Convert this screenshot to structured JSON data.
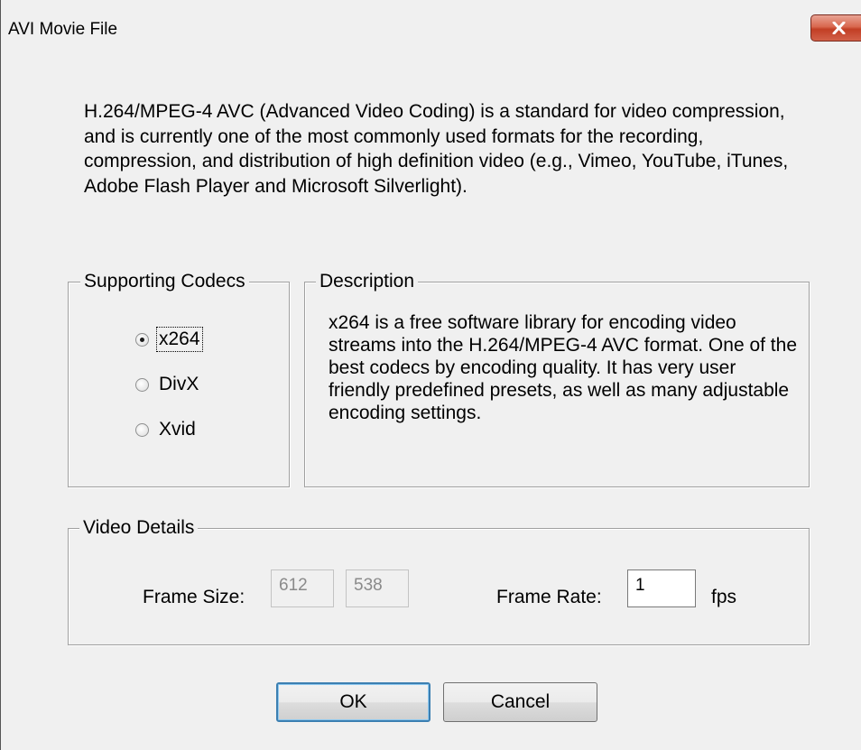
{
  "window": {
    "title": "AVI Movie File",
    "close_icon": "close-x-icon",
    "close_color": "#c74a32"
  },
  "intro": {
    "text": "H.264/MPEG-4 AVC (Advanced Video Coding) is a standard for video compression, and is currently one of the most commonly used formats for the recording, compression, and distribution of high definition video (e.g., Vimeo, YouTube, iTunes, Adobe Flash Player and Microsoft Silverlight)."
  },
  "codecs": {
    "legend": "Supporting Codecs",
    "options": [
      {
        "label": "x264",
        "selected": true
      },
      {
        "label": "DivX",
        "selected": false
      },
      {
        "label": "Xvid",
        "selected": false
      }
    ]
  },
  "description": {
    "legend": "Description",
    "text": "x264 is a free software library for encoding video streams into the H.264/MPEG-4 AVC format. One of the best codecs by encoding quality. It has very user friendly predefined presets, as well as many adjustable encoding settings."
  },
  "video_details": {
    "legend": "Video Details",
    "frame_size_label": "Frame Size:",
    "frame_width": "612",
    "frame_height": "538",
    "frame_rate_label": "Frame Rate:",
    "frame_rate": "1",
    "fps_label": "fps"
  },
  "buttons": {
    "ok": "OK",
    "cancel": "Cancel"
  }
}
